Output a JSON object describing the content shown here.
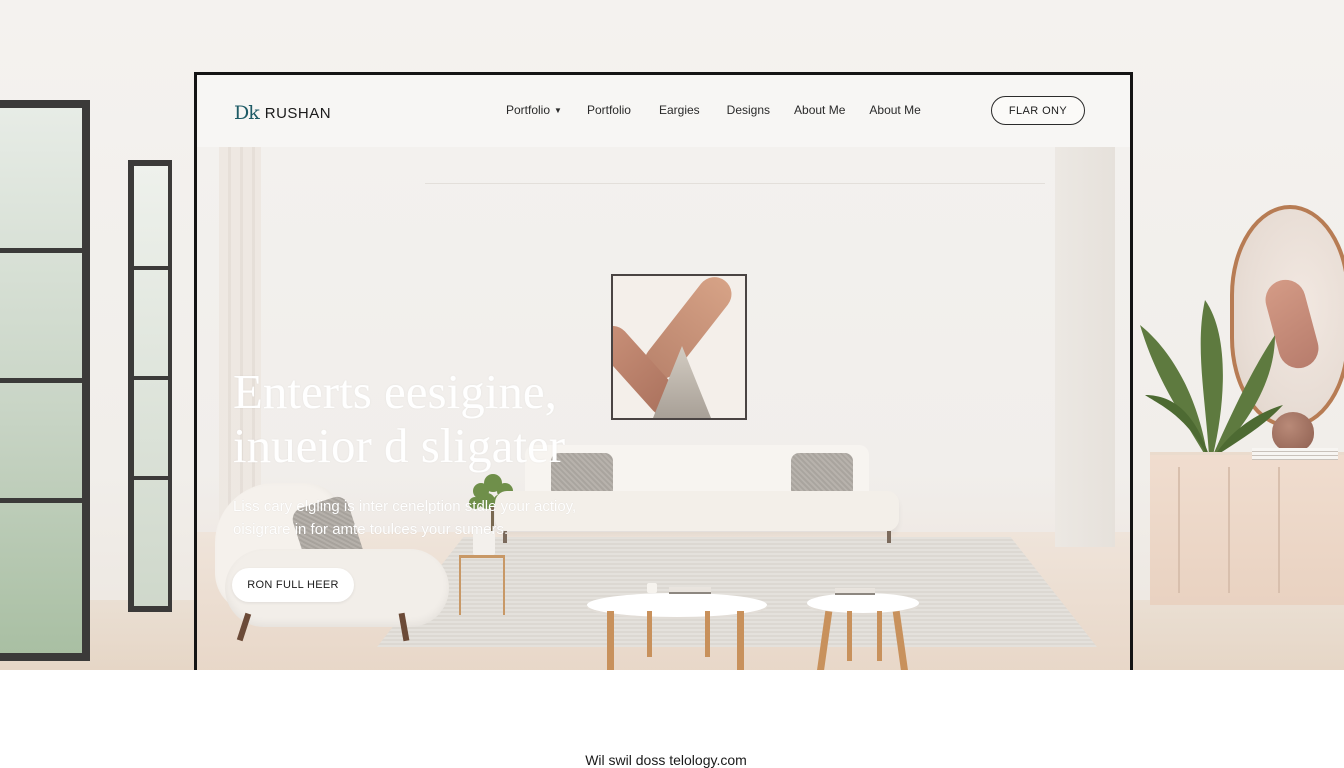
{
  "brand": {
    "logo_mark": "Dk",
    "logo_text": "RUSHAN"
  },
  "nav": {
    "items": [
      {
        "label": "Portfolio",
        "has_dropdown": true
      },
      {
        "label": "Portfolio"
      },
      {
        "label": "Eargies"
      },
      {
        "label": "Designs"
      },
      {
        "label": "About Me"
      },
      {
        "label": "About Me"
      }
    ],
    "cta_label": "FLAR ONY"
  },
  "hero": {
    "headline_line1": "Enterts eesigine,",
    "headline_line2": "inueior d sligater",
    "subtext_line1": "Liss cary elgling is inter cenelption stdle your actioy,",
    "subtext_line2": "oisigrare in for amte toulces your sumers.",
    "button_label": "RON FULL HEER"
  },
  "footer": {
    "caption": "Wil swil doss telology.com"
  },
  "colors": {
    "frame_border": "#141414",
    "logo_accent": "#1e5b66",
    "hero_text": "#ffffff",
    "page_bg": "#f6f4f1"
  },
  "icons": [
    "chevron-down-icon",
    "logo-mark-icon"
  ]
}
